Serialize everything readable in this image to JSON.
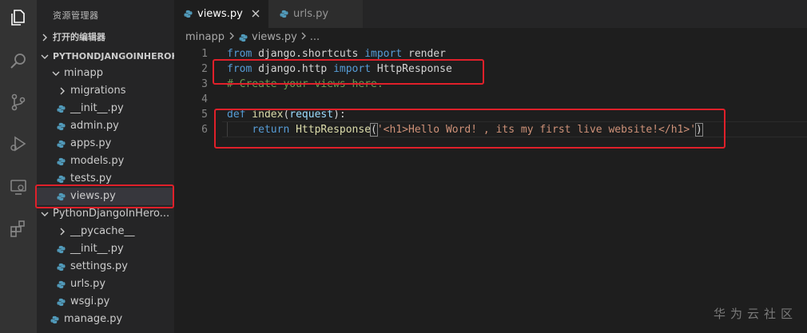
{
  "sidebar": {
    "title": "资源管理器",
    "open_editors": "打开的编辑器",
    "project": "PYTHONDJANGOINHEROK...",
    "tree": [
      {
        "label": "minapp",
        "type": "folder-open",
        "indent": 1
      },
      {
        "label": "migrations",
        "type": "folder-closed",
        "indent": 2
      },
      {
        "label": "__init__.py",
        "type": "py",
        "indent": 2
      },
      {
        "label": "admin.py",
        "type": "py",
        "indent": 2
      },
      {
        "label": "apps.py",
        "type": "py",
        "indent": 2
      },
      {
        "label": "models.py",
        "type": "py",
        "indent": 2
      },
      {
        "label": "tests.py",
        "type": "py",
        "indent": 2
      },
      {
        "label": "views.py",
        "type": "py",
        "indent": 2
      },
      {
        "label": "PythonDjangoInHero...",
        "type": "folder-open",
        "indent": 1
      },
      {
        "label": "__pycache__",
        "type": "folder-closed",
        "indent": 2
      },
      {
        "label": "__init__.py",
        "type": "py",
        "indent": 2
      },
      {
        "label": "settings.py",
        "type": "py",
        "indent": 2
      },
      {
        "label": "urls.py",
        "type": "py",
        "indent": 2
      },
      {
        "label": "wsgi.py",
        "type": "py",
        "indent": 2
      },
      {
        "label": "manage.py",
        "type": "py",
        "indent": 1
      }
    ]
  },
  "tabs": [
    {
      "label": "views.py",
      "active": true
    },
    {
      "label": "urls.py",
      "active": false
    }
  ],
  "breadcrumb": {
    "folder": "minapp",
    "file": "views.py",
    "tail": "..."
  },
  "code": {
    "line_numbers": [
      "1",
      "2",
      "3",
      "4",
      "5",
      "6"
    ],
    "l1": {
      "kw1": "from",
      "mod": " django.shortcuts ",
      "kw2": "import",
      "name": " render"
    },
    "l2": {
      "kw1": "from",
      "mod": " django.http ",
      "kw2": "import",
      "name": " HttpResponse"
    },
    "l3": {
      "comment": "# Create your views here."
    },
    "l5": {
      "kw": "def",
      "fn": " index",
      "open": "(",
      "param": "request",
      "close": "):"
    },
    "l6": {
      "indent": "    ",
      "kw": "return",
      "fn": " HttpResponse",
      "open": "(",
      "str": "'<h1>Hello Word! , its my first live website!</h1>'",
      "close": ")"
    }
  },
  "watermark": "华为云社区",
  "colors": {
    "highlight": "#e0202a",
    "python_icon": "#519aba"
  }
}
